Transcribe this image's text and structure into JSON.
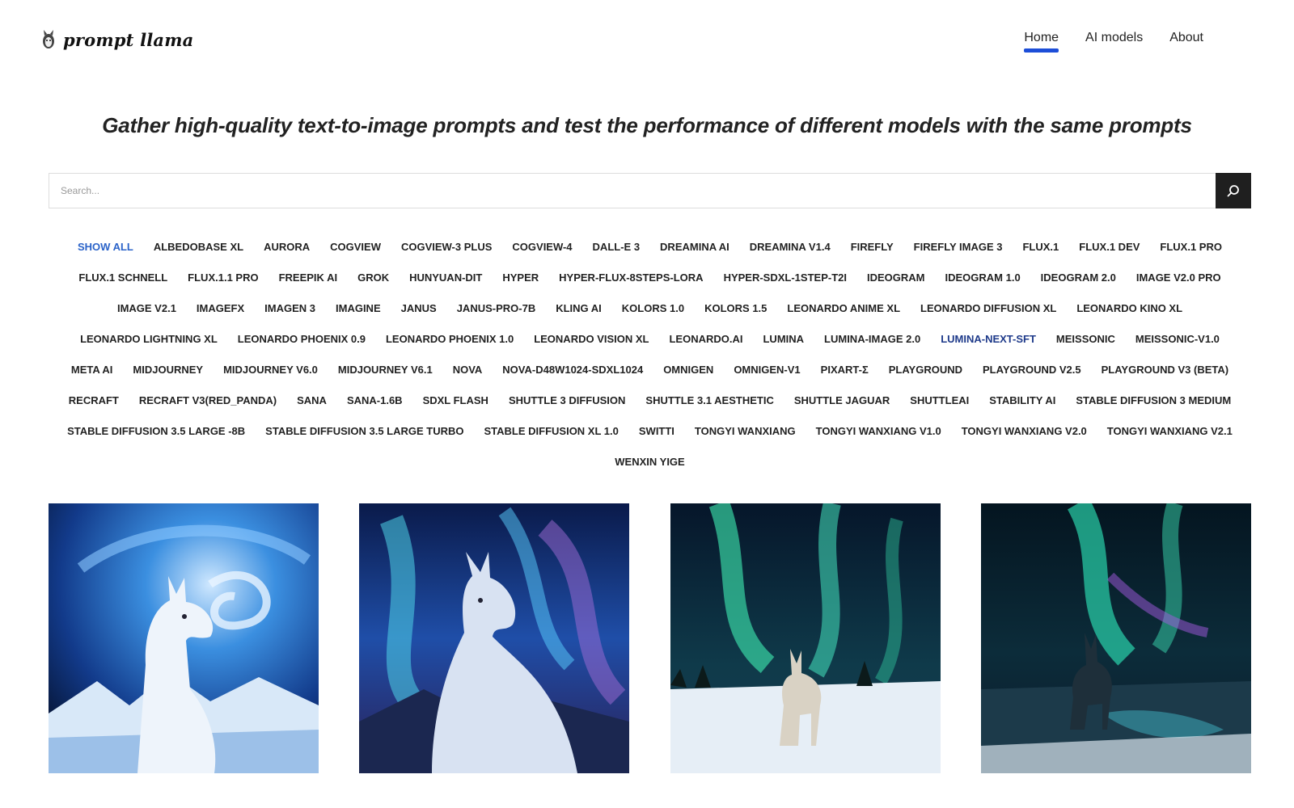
{
  "brand": {
    "name": "prompt llama"
  },
  "nav": [
    {
      "label": "Home",
      "active": true
    },
    {
      "label": "AI models",
      "active": false
    },
    {
      "label": "About",
      "active": false
    }
  ],
  "hero": {
    "title": "Gather high-quality text-to-image prompts and test the performance of different models with the same prompts"
  },
  "search": {
    "placeholder": "Search...",
    "value": ""
  },
  "tags": [
    "SHOW ALL",
    "ALBEDOBASE XL",
    "AURORA",
    "COGVIEW",
    "COGVIEW-3 PLUS",
    "COGVIEW-4",
    "DALL-E 3",
    "DREAMINA AI",
    "DREAMINA V1.4",
    "FIREFLY",
    "FIREFLY IMAGE 3",
    "FLUX.1",
    "FLUX.1 DEV",
    "FLUX.1 PRO",
    "FLUX.1 SCHNELL",
    "FLUX.1.1 PRO",
    "FREEPIK AI",
    "GROK",
    "HUNYUAN-DIT",
    "HYPER",
    "HYPER-FLUX-8STEPS-LORA",
    "HYPER-SDXL-1STEP-T2I",
    "IDEOGRAM",
    "IDEOGRAM 1.0",
    "IDEOGRAM 2.0",
    "IMAGE V2.0 PRO",
    "IMAGE V2.1",
    "IMAGEFX",
    "IMAGEN 3",
    "IMAGINE",
    "JANUS",
    "JANUS-PRO-7B",
    "KLING AI",
    "KOLORS 1.0",
    "KOLORS 1.5",
    "LEONARDO ANIME XL",
    "LEONARDO DIFFUSION XL",
    "LEONARDO KINO XL",
    "LEONARDO LIGHTNING XL",
    "LEONARDO PHOENIX 0.9",
    "LEONARDO PHOENIX 1.0",
    "LEONARDO VISION XL",
    "LEONARDO.AI",
    "LUMINA",
    "LUMINA-IMAGE 2.0",
    "LUMINA-NEXT-SFT",
    "MEISSONIC",
    "MEISSONIC-V1.0",
    "META AI",
    "MIDJOURNEY",
    "MIDJOURNEY V6.0",
    "MIDJOURNEY V6.1",
    "NOVA",
    "NOVA-D48W1024-SDXL1024",
    "OMNIGEN",
    "OMNIGEN-V1",
    "PIXART-Σ",
    "PLAYGROUND",
    "PLAYGROUND V2.5",
    "PLAYGROUND V3 (BETA)",
    "RECRAFT",
    "RECRAFT V3(RED_PANDA)",
    "SANA",
    "SANA-1.6B",
    "SDXL FLASH",
    "SHUTTLE 3 DIFFUSION",
    "SHUTTLE 3.1 AESTHETIC",
    "SHUTTLE JAGUAR",
    "SHUTTLEAI",
    "STABILITY AI",
    "STABLE DIFFUSION 3 MEDIUM",
    "STABLE DIFFUSION 3.5 LARGE -8B",
    "STABLE DIFFUSION 3.5 LARGE TURBO",
    "STABLE DIFFUSION XL 1.0",
    "SWITTI",
    "TONGYI WANXIANG",
    "TONGYI WANXIANG V1.0",
    "TONGYI WANXIANG V2.0",
    "TONGYI WANXIANG V2.1",
    "WENXIN YIGE"
  ],
  "active_tag": "SHOW ALL",
  "highlight_tag": "LUMINA-NEXT-SFT",
  "colors": {
    "accent": "#1d4ed8",
    "tag_active": "#2b63c9",
    "tag_highlight": "#1e3a8a",
    "search_button": "#1f1f1f"
  },
  "gallery": [
    {
      "icon": "llama-starry-swirl-image"
    },
    {
      "icon": "llama-aurora-portrait-image"
    },
    {
      "icon": "llama-aurora-snowfield-image"
    },
    {
      "icon": "llama-aurora-lake-image"
    }
  ]
}
